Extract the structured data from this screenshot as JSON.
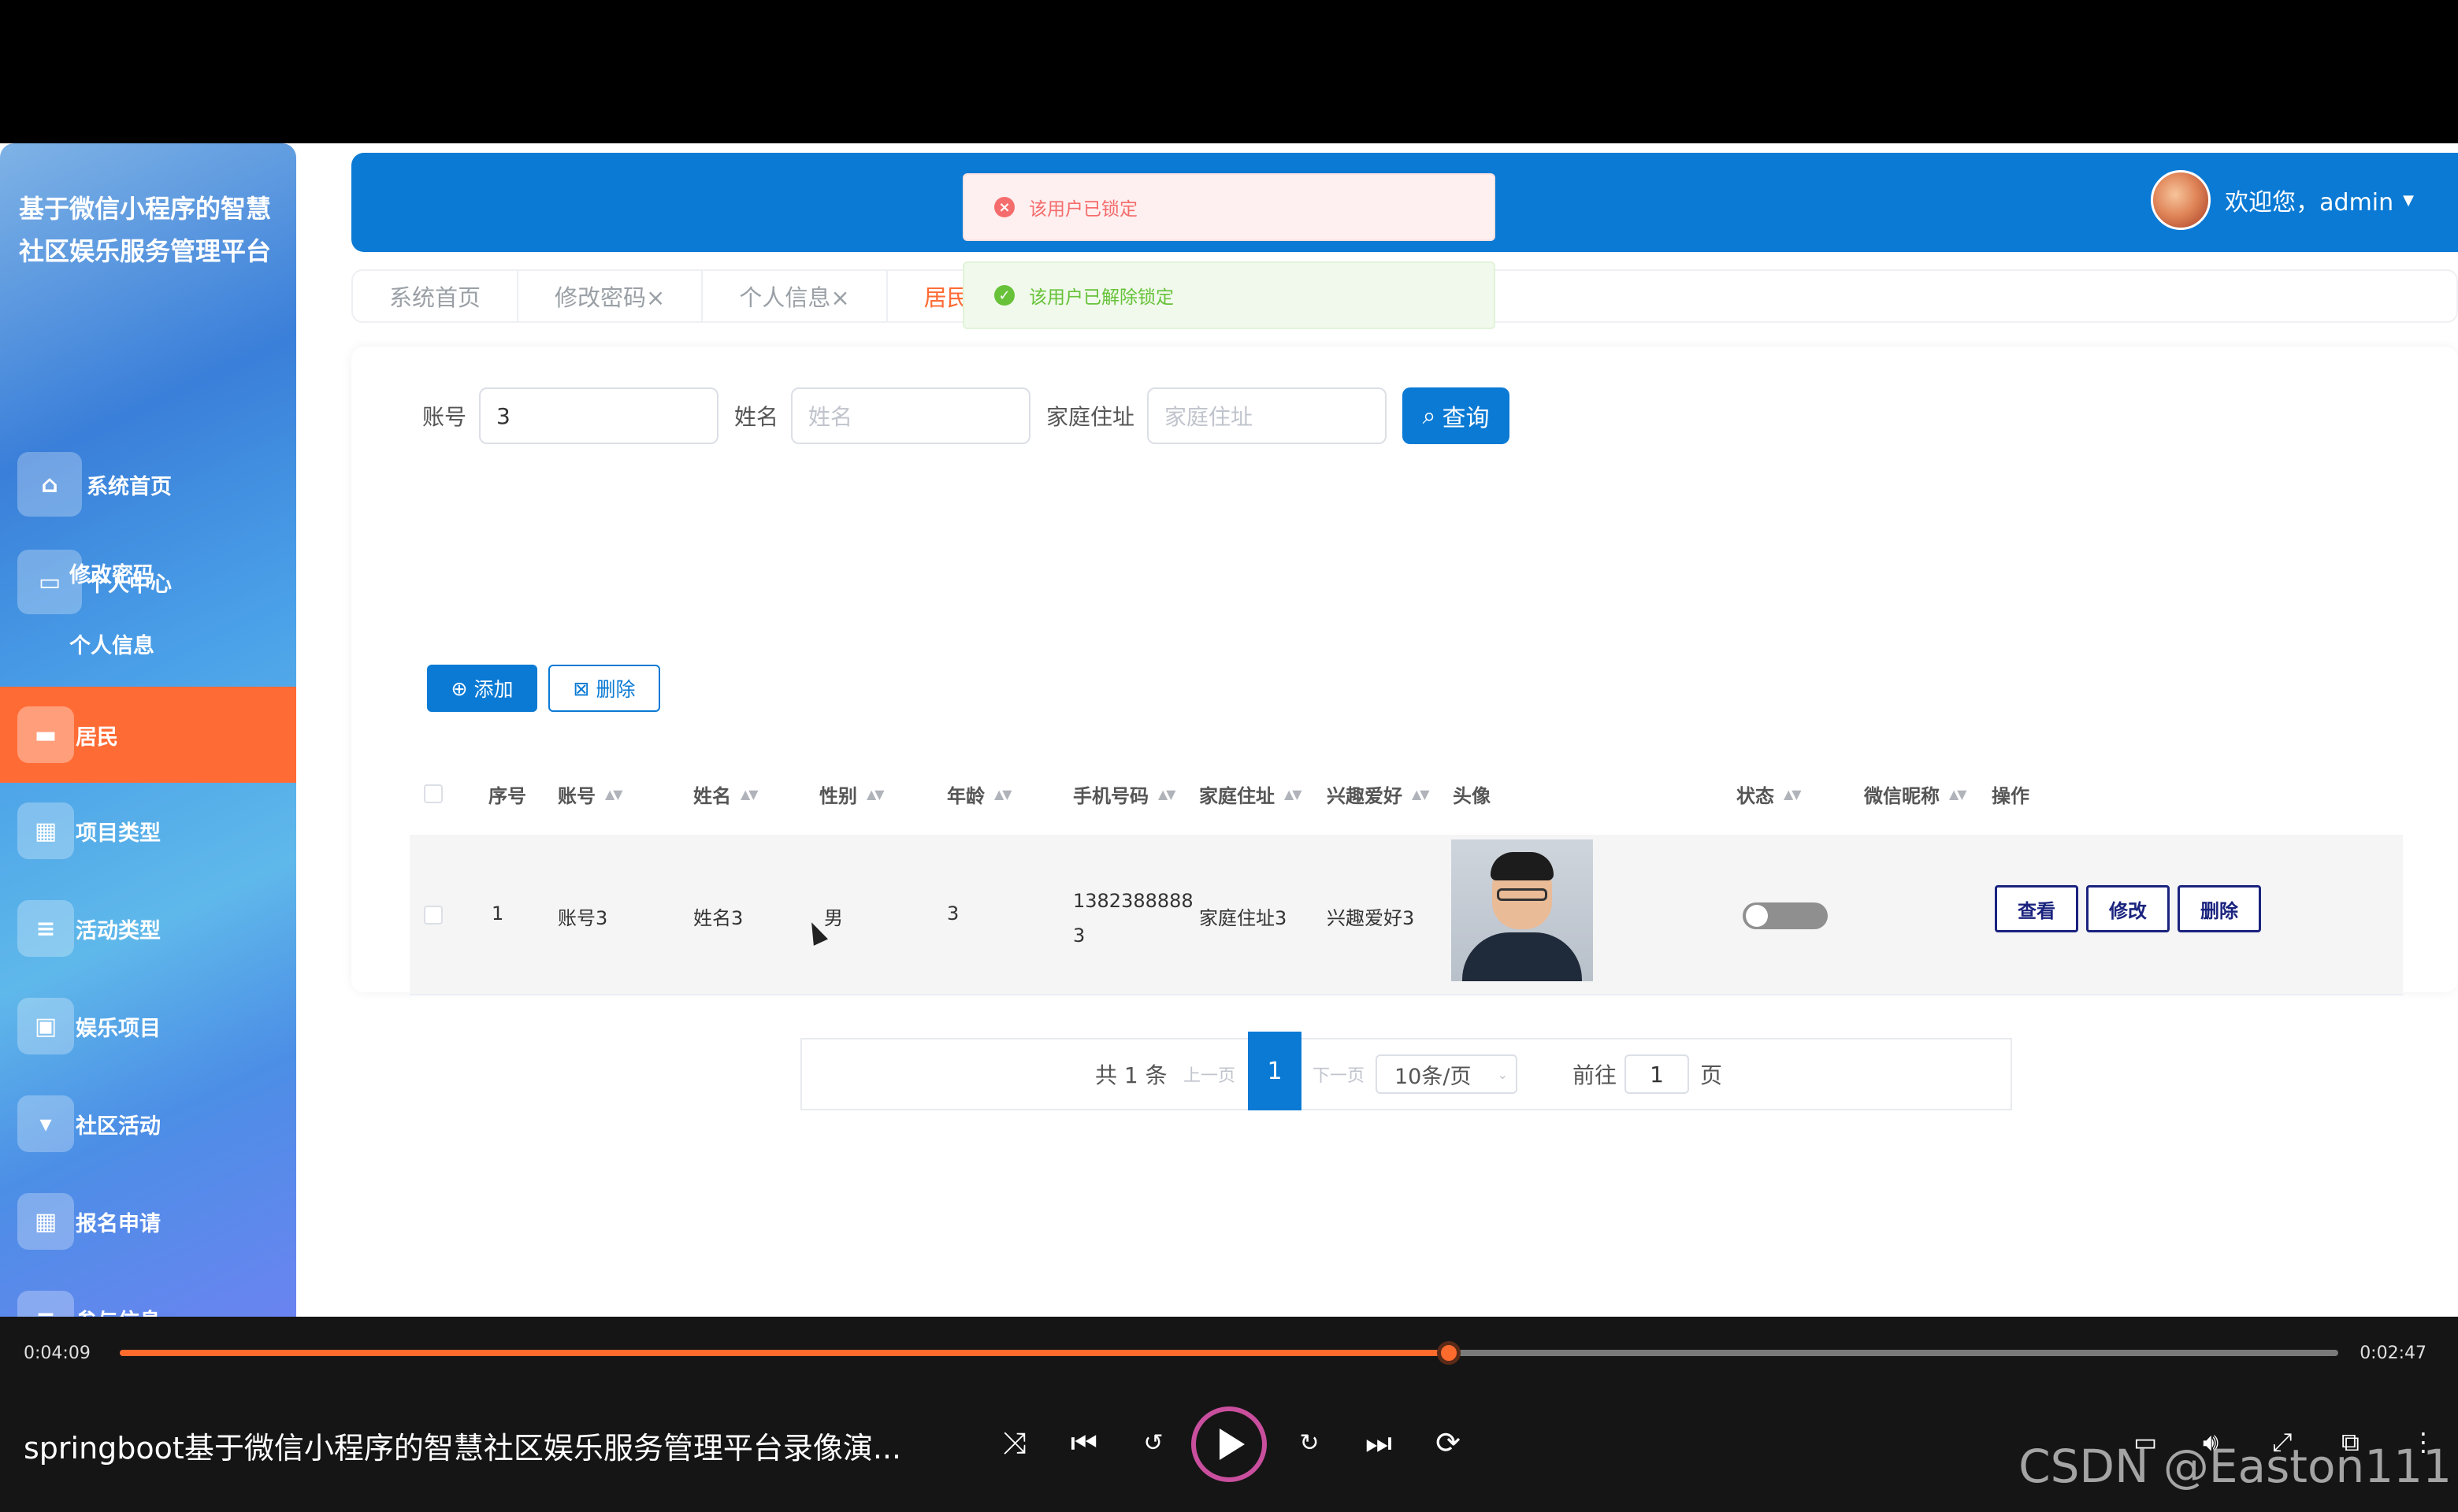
{
  "app": {
    "title": "基于微信小程序的智慧社区娱乐服务管理平台",
    "colors": {
      "primary": "#0a7ad4",
      "active": "#ff6b35",
      "error": "#f56c6c",
      "success": "#67c23a"
    }
  },
  "sidebar": {
    "items": [
      {
        "label": "系统首页",
        "icon": "home-icon"
      },
      {
        "label": "个人中心",
        "icon": "id-card-icon"
      },
      {
        "label": "修改密码"
      },
      {
        "label": "个人信息"
      },
      {
        "label": "居民",
        "icon": "monitor-icon",
        "active": true
      },
      {
        "label": "项目类型",
        "icon": "grid-icon"
      },
      {
        "label": "活动类型",
        "icon": "list-icon"
      },
      {
        "label": "娱乐项目",
        "icon": "clipboard-icon"
      },
      {
        "label": "社区活动",
        "icon": "signboard-icon"
      },
      {
        "label": "报名申请",
        "icon": "grid-icon"
      },
      {
        "label": "参与信息",
        "icon": "list-icon"
      }
    ]
  },
  "header": {
    "welcome": "欢迎您，admin"
  },
  "tabs": [
    {
      "label": "系统首页"
    },
    {
      "label": "修改密码×"
    },
    {
      "label": "个人信息×"
    },
    {
      "label": "居民×",
      "active": true
    }
  ],
  "toasts": {
    "error": "该用户已锁定",
    "success": "该用户已解除锁定"
  },
  "search": {
    "account_label": "账号",
    "account_value": "3",
    "name_label": "姓名",
    "name_placeholder": "姓名",
    "address_label": "家庭住址",
    "address_placeholder": "家庭住址",
    "query_label": "查询"
  },
  "actions": {
    "add_label": "添加",
    "delete_label": "删除"
  },
  "table": {
    "columns": [
      "序号",
      "账号",
      "姓名",
      "性别",
      "年龄",
      "手机号码",
      "家庭住址",
      "兴趣爱好",
      "头像",
      "状态",
      "微信昵称",
      "操作"
    ],
    "rows": [
      {
        "index": "1",
        "account": "账号3",
        "name": "姓名3",
        "gender": "男",
        "age": "3",
        "phone_line1": "1382388888",
        "phone_line2": "3",
        "address": "家庭住址3",
        "hobby": "兴趣爱好3",
        "status_on": false,
        "wechat_nickname": "",
        "ops": [
          "查看",
          "修改",
          "删除"
        ]
      }
    ]
  },
  "pagination": {
    "total": "共 1 条",
    "prev": "上一页",
    "current": "1",
    "next": "下一页",
    "page_size": "10条/页",
    "goto_label": "前往",
    "goto_value": "1",
    "goto_unit": "页"
  },
  "player": {
    "elapsed": "0:04:09",
    "duration": "0:02:47",
    "progress": 0.599,
    "title": "springboot基于微信小程序的智慧社区娱乐服务管理平台录像演...",
    "watermark": "CSDN @Easton111"
  }
}
